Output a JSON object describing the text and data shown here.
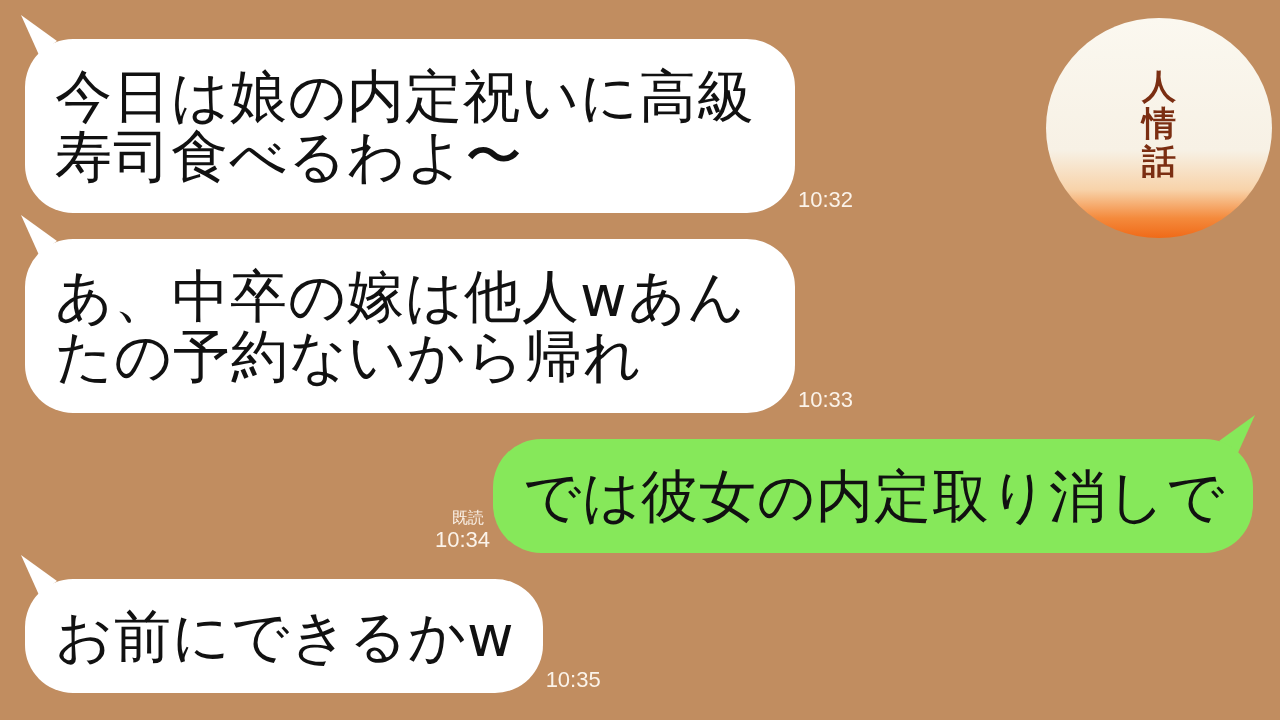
{
  "messages": [
    {
      "kind": "incoming",
      "text": "今日は娘の内定祝いに高級寿司食べるわよ〜",
      "time": "10:32"
    },
    {
      "kind": "incoming",
      "text": "あ、中卒の嫁は他人wあんたの予約ないから帰れ",
      "time": "10:33"
    },
    {
      "kind": "outgoing",
      "text": "では彼女の内定取り消しで",
      "read_label": "既読",
      "time": "10:34"
    },
    {
      "kind": "incoming",
      "text": "お前にできるかw",
      "time": "10:35"
    }
  ],
  "logo": {
    "text": "人情話"
  }
}
